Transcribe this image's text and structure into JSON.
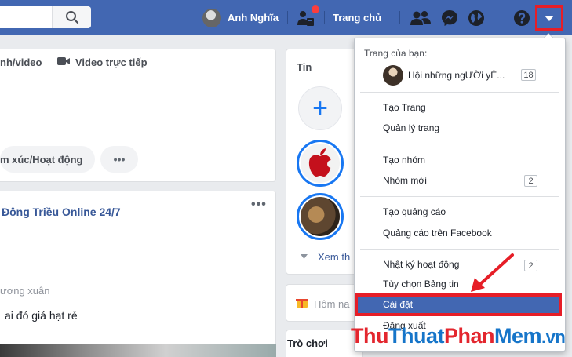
{
  "topbar": {
    "user_name": "Anh Nghĩa",
    "home_label": "Trang chủ"
  },
  "composer": {
    "tab_photo": "nh/video",
    "tab_live": "Video trực tiếp",
    "feeling_label": "m xúc/Hoạt động",
    "more_label": "•••"
  },
  "feed_post": {
    "title": "Đông Triều Online 24/7",
    "menu": "•••",
    "meta": "ương xuân",
    "text": "ai đó giá hạt rẻ"
  },
  "stories": {
    "title": "Tin",
    "see_more": "Xem th",
    "add_symbol": "+"
  },
  "right_column": {
    "hom_label": "Hôm na",
    "games_title": "Trò chơi"
  },
  "dropdown": {
    "header": "Trang của bạn:",
    "page": {
      "name": "Hội những ngƯỜi yÊ...",
      "count": "18"
    },
    "items": [
      {
        "label": "Tạo Trang"
      },
      {
        "label": "Quản lý trang"
      },
      {
        "label": "Tạo nhóm"
      },
      {
        "label": "Nhóm mới",
        "badge": "2"
      },
      {
        "label": "Tạo quảng cáo"
      },
      {
        "label": "Quảng cáo trên Facebook"
      },
      {
        "label": "Nhật ký hoạt động",
        "badge": "2"
      },
      {
        "label": "Tùy chọn Bảng tin"
      },
      {
        "label": "Cài đặt"
      },
      {
        "label": "Đăng xuất"
      }
    ]
  },
  "watermark": {
    "part1": "Thu",
    "part2": "Thuat",
    "part3": "Phan",
    "part4": "Mem",
    "part5": ".vn"
  },
  "colors": {
    "brand_blue": "#4267b2",
    "highlight_red": "#e61e27"
  }
}
